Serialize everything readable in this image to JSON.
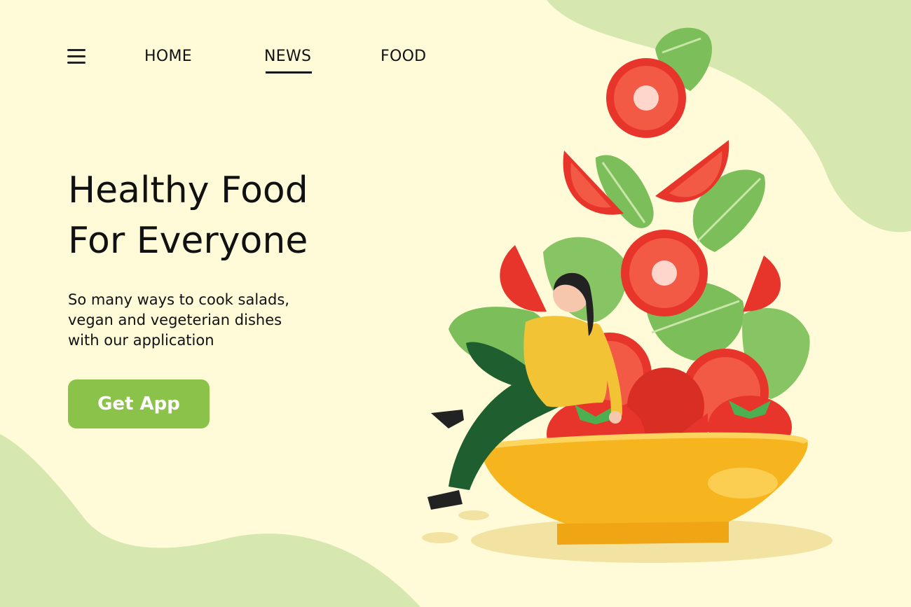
{
  "nav": {
    "menu_icon": "hamburger-menu-icon",
    "items": [
      {
        "label": "HOME",
        "active": false
      },
      {
        "label": "NEWS",
        "active": true
      },
      {
        "label": "FOOD",
        "active": false
      }
    ]
  },
  "hero": {
    "headline_line1": "Healthy Food",
    "headline_line2": "For Everyone",
    "subtitle_line1": "So many ways to cook salads,",
    "subtitle_line2": "vegan and vegeterian dishes",
    "subtitle_line3": "with our application",
    "cta_label": "Get App"
  },
  "colors": {
    "background": "#fffbd9",
    "accent_green": "#8bc34a",
    "blob_green": "#d6e8b0",
    "tomato_red": "#e8352b",
    "bowl_yellow": "#f6b51e"
  }
}
